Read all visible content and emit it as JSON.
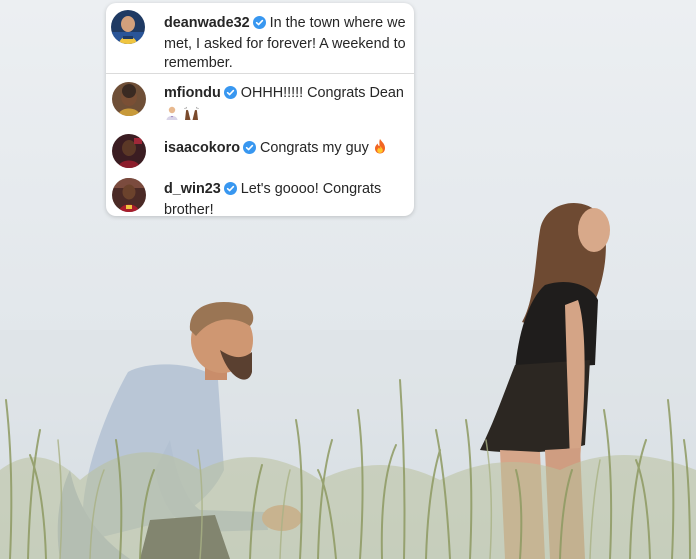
{
  "comments": [
    {
      "username": "deanwade32",
      "text": "In the town where we met, I asked for forever! A weekend to remember.",
      "emoji": [],
      "verified": true
    },
    {
      "username": "mfiondu",
      "text": "OHHH!!!!! Congrats Dean",
      "emoji": [
        "man-in-tuxedo-icon",
        "raised-hands-icon"
      ],
      "verified": true
    },
    {
      "username": "isaacokoro",
      "text": "Congrats my guy",
      "emoji": [
        "fire-icon"
      ],
      "verified": true
    },
    {
      "username": "d_win23",
      "text": "Let's goooo! Congrats brother!",
      "emoji": [],
      "verified": true
    }
  ],
  "colors": {
    "verified_badge": "#3897f0",
    "text": "#262626",
    "card_background": "#ffffff",
    "divider": "#dbdbdb"
  }
}
